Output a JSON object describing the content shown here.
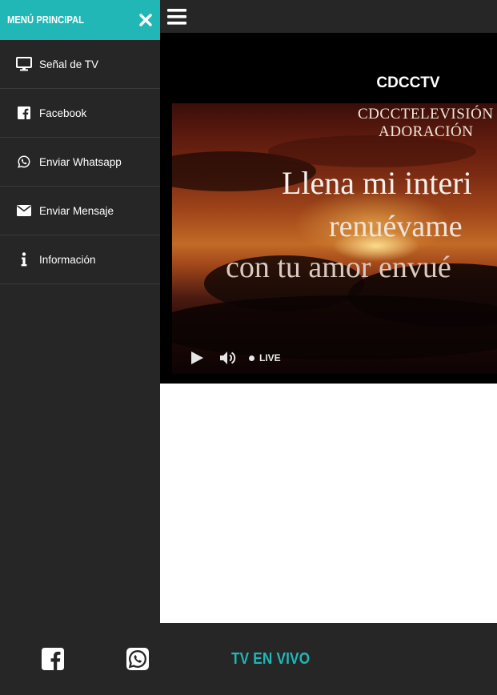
{
  "sidebar": {
    "title": "MENÚ PRINCIPAL",
    "accent_color": "#20b7b6",
    "items": [
      {
        "label": "Señal de TV",
        "icon": "monitor-icon"
      },
      {
        "label": "Facebook",
        "icon": "facebook-icon"
      },
      {
        "label": "Enviar Whatsapp",
        "icon": "whatsapp-icon"
      },
      {
        "label": "Enviar Mensaje",
        "icon": "envelope-icon"
      },
      {
        "label": "Información",
        "icon": "info-icon"
      }
    ]
  },
  "player": {
    "title": "CDCCTV",
    "video_text": {
      "line1": "CDCCTELEVISIÓN",
      "line2": "ADORACIÓN",
      "line3": "Llena mi interi",
      "line4": "renuévame",
      "line5": "con tu amor envué"
    },
    "live_label": "LIVE"
  },
  "footer": {
    "live_link": "TV EN VIVO"
  }
}
